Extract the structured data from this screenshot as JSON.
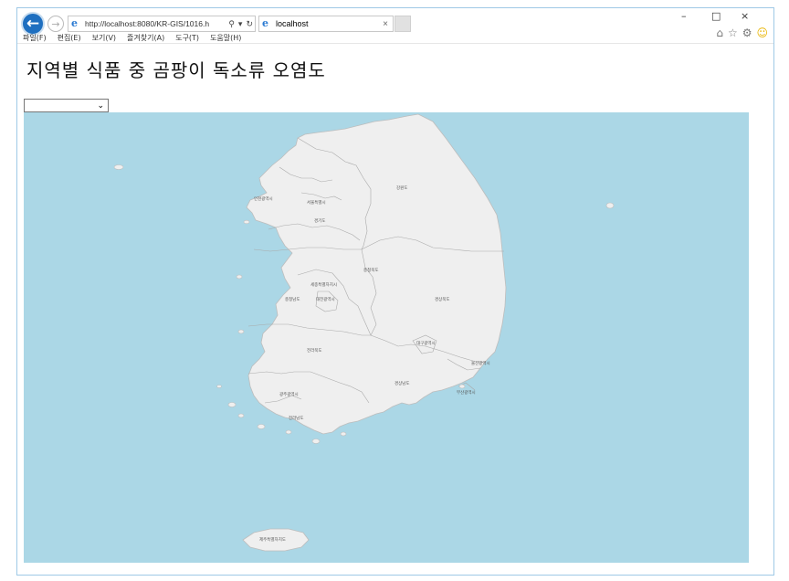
{
  "browser": {
    "url": "http://localhost:8080/KR-GIS/1016.h",
    "tab_title": "localhost",
    "menu": [
      "파일(F)",
      "편집(E)",
      "보기(V)",
      "즐겨찾기(A)",
      "도구(T)",
      "도움말(H)"
    ],
    "window_controls": {
      "minimize": "–",
      "maximize": "□",
      "close": "×"
    }
  },
  "page": {
    "title": "지역별 식품 중 곰팡이 독소류 오염도",
    "region_select": {
      "value": ""
    }
  },
  "map": {
    "background": "#abd7e6",
    "land": "#efefef",
    "region_labels": {
      "gangwon": "강원도",
      "incheon": "인천광역시",
      "seoul": "서울특별시",
      "gyeonggi": "경기도",
      "chungbuk": "충청북도",
      "sejong": "세종특별자치시",
      "chungnam": "충청남도",
      "daejeon": "대전광역시",
      "gyeongbuk": "경상북도",
      "daegu": "대구광역시",
      "jeonbuk": "전라북도",
      "ulsan": "울산광역시",
      "gyeongnam": "경상남도",
      "busan": "부산광역시",
      "gwangju": "광주광역시",
      "jeonnam": "전라남도",
      "jeju": "제주특별자치도"
    }
  }
}
